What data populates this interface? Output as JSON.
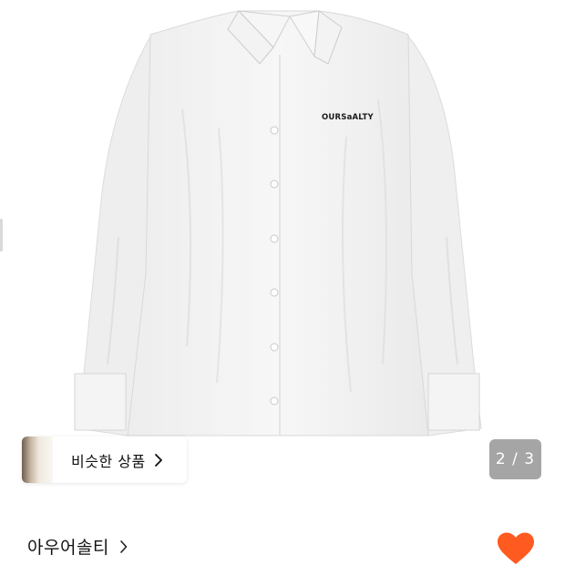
{
  "gallery": {
    "logo_text": "OURSaALTY",
    "counter": "2 / 3"
  },
  "similar": {
    "label": "비슷한 상품"
  },
  "brand": {
    "name": "아우어솔티"
  },
  "like": {
    "active": true,
    "color": "#ff5a1f"
  },
  "icons": [
    "chevron-right-icon",
    "heart-icon"
  ]
}
